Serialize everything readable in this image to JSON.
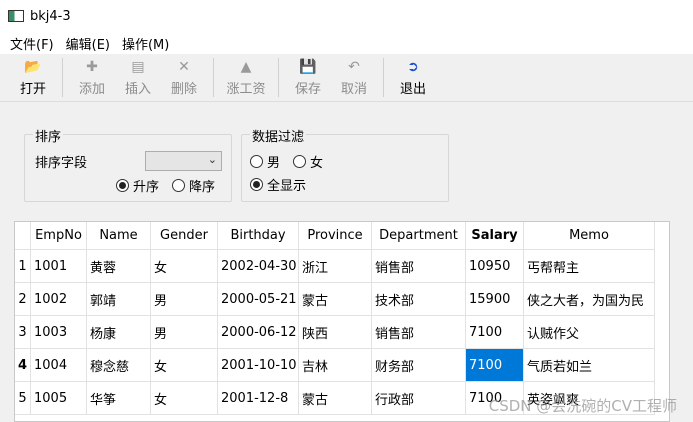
{
  "window": {
    "title": "bkj4-3"
  },
  "menu": [
    {
      "label": "文件(F)"
    },
    {
      "label": "编辑(E)"
    },
    {
      "label": "操作(M)"
    }
  ],
  "toolbar": [
    {
      "label": "打开",
      "icon": "open-folder-icon",
      "enabled": true
    },
    {
      "label": "添加",
      "icon": "add-icon",
      "enabled": false
    },
    {
      "label": "插入",
      "icon": "insert-icon",
      "enabled": false
    },
    {
      "label": "删除",
      "icon": "delete-icon",
      "enabled": false
    },
    {
      "label": "涨工资",
      "icon": "raise-salary-icon",
      "enabled": false
    },
    {
      "label": "保存",
      "icon": "save-icon",
      "enabled": false
    },
    {
      "label": "取消",
      "icon": "undo-icon",
      "enabled": false
    },
    {
      "label": "退出",
      "icon": "exit-icon",
      "enabled": true
    }
  ],
  "sort_group": {
    "title": "排序",
    "field_label": "排序字段",
    "field_value": "",
    "asc_label": "升序",
    "desc_label": "降序",
    "selected": "asc"
  },
  "filter_group": {
    "title": "数据过滤",
    "male_label": "男",
    "female_label": "女",
    "all_label": "全显示",
    "selected": "all"
  },
  "table": {
    "columns": [
      "EmpNo",
      "Name",
      "Gender",
      "Birthday",
      "Province",
      "Department",
      "Salary",
      "Memo"
    ],
    "rows": [
      {
        "num": "1",
        "cells": [
          "1001",
          "黄蓉",
          "女",
          "2002-04-30",
          "浙江",
          "销售部",
          "10950",
          "丐帮帮主"
        ]
      },
      {
        "num": "2",
        "cells": [
          "1002",
          "郭靖",
          "男",
          "2000-05-21",
          "蒙古",
          "技术部",
          "15900",
          "侠之大者，为国为民"
        ]
      },
      {
        "num": "3",
        "cells": [
          "1003",
          "杨康",
          "男",
          "2000-06-12",
          "陕西",
          "销售部",
          "7100",
          "认贼作父"
        ]
      },
      {
        "num": "4",
        "cells": [
          "1004",
          "穆念慈",
          "女",
          "2001-10-10",
          "吉林",
          "财务部",
          "7100",
          "气质若如兰"
        ]
      },
      {
        "num": "5",
        "cells": [
          "1005",
          "华筝",
          "女",
          "2001-12-8",
          "蒙古",
          "行政部",
          "7100",
          "英姿飒爽"
        ]
      }
    ],
    "selected_row": "4",
    "selected_column": "Salary"
  },
  "watermark": "CSDN @会洗碗的CV工程师"
}
